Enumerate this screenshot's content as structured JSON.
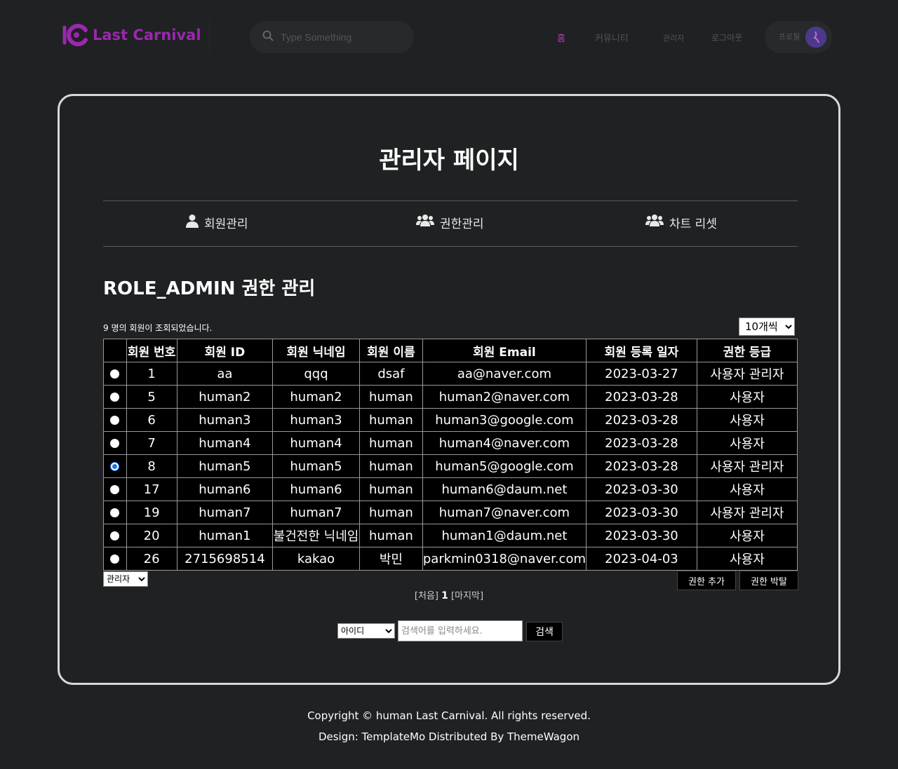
{
  "header": {
    "logo_text": "Last Carnival",
    "search_placeholder": "Type Something",
    "nav": [
      {
        "label": "홈",
        "active": true
      },
      {
        "label": "커뮤니티",
        "active": false
      },
      {
        "label": "관리자",
        "active": false
      },
      {
        "label": "로그아웃",
        "active": false
      }
    ],
    "profile_label": "프로필"
  },
  "page": {
    "title": "관리자 페이지",
    "menu": [
      {
        "label": "회원관리",
        "icon": "user-icon"
      },
      {
        "label": "권한관리",
        "icon": "users-icon"
      },
      {
        "label": "차트 리셋",
        "icon": "users-icon"
      }
    ],
    "section_title": "ROLE_ADMIN 권한 관리",
    "count_text": "9 명의 회원이 조회되었습니다.",
    "per_page": "10개씩"
  },
  "table": {
    "headers": [
      "회원 번호",
      "회원 ID",
      "회원 닉네임",
      "회원 이름",
      "회원 Email",
      "회원 등록 일자",
      "권한 등급"
    ],
    "rows": [
      {
        "selected": false,
        "cells": [
          "1",
          "aa",
          "qqq",
          "dsaf",
          "aa@naver.com",
          "2023-03-27",
          "사용자 관리자"
        ]
      },
      {
        "selected": false,
        "cells": [
          "5",
          "human2",
          "human2",
          "human",
          "human2@naver.com",
          "2023-03-28",
          "사용자"
        ]
      },
      {
        "selected": false,
        "cells": [
          "6",
          "human3",
          "human3",
          "human",
          "human3@google.com",
          "2023-03-28",
          "사용자"
        ]
      },
      {
        "selected": false,
        "cells": [
          "7",
          "human4",
          "human4",
          "human",
          "human4@naver.com",
          "2023-03-28",
          "사용자"
        ]
      },
      {
        "selected": true,
        "cells": [
          "8",
          "human5",
          "human5",
          "human",
          "human5@google.com",
          "2023-03-28",
          "사용자 관리자"
        ]
      },
      {
        "selected": false,
        "cells": [
          "17",
          "human6",
          "human6",
          "human",
          "human6@daum.net",
          "2023-03-30",
          "사용자"
        ]
      },
      {
        "selected": false,
        "cells": [
          "19",
          "human7",
          "human7",
          "human",
          "human7@naver.com",
          "2023-03-30",
          "사용자 관리자"
        ]
      },
      {
        "selected": false,
        "cells": [
          "20",
          "human1",
          "불건전한 닉네임",
          "human",
          "human1@daum.net",
          "2023-03-30",
          "사용자"
        ]
      },
      {
        "selected": false,
        "cells": [
          "26",
          "2715698514",
          "kakao",
          "박민",
          "parkmin0318@naver.com",
          "2023-04-03",
          "사용자"
        ]
      }
    ]
  },
  "controls": {
    "role_select": "관리자",
    "add_role": "권한 추가",
    "remove_role": "권한 박탈",
    "pager_first": "[처음]",
    "pager_current": "1",
    "pager_last": "[마지막]",
    "search_type": "아이디",
    "search_placeholder": "검색어를 입력하세요.",
    "search_button": "검색"
  },
  "footer": {
    "copyright": "Copyright © human Last Carnival. All rights reserved.",
    "design": "Design: TemplateMo Distributed By ThemeWagon"
  },
  "colors": {
    "background": "#1f2122",
    "accent": "#9c27b0",
    "active_nav": "#b03ab3",
    "card_border": "#d8d8d8",
    "radio_selected": "#1a73e8"
  }
}
